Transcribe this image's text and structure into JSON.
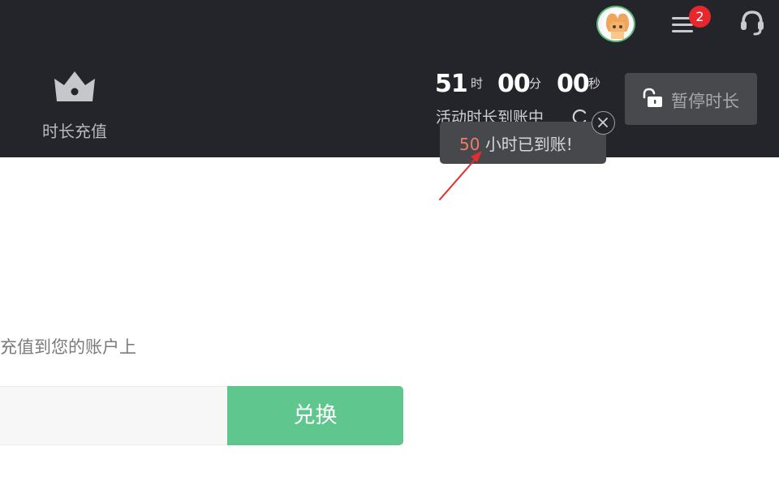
{
  "header": {
    "notification_count": "2",
    "recharge_nav": {
      "label": "时长充值",
      "icon": "crown-icon"
    },
    "timer": {
      "hours": "51",
      "hours_unit": "时",
      "minutes": "00",
      "minutes_unit": "分",
      "seconds": "00",
      "seconds_unit": "秒",
      "status": "活动时长到账中"
    },
    "pause_button": {
      "label": "暂停时长",
      "icon": "unlock-icon"
    }
  },
  "toast": {
    "number": "50",
    "message": "小时已到账!"
  },
  "main": {
    "description": "充值到您的账户上",
    "code_input": {
      "value": "",
      "placeholder": ""
    },
    "redeem_button": {
      "label": "兑换"
    }
  },
  "colors": {
    "header_bg": "#24252a",
    "accent_green": "#5fc68e",
    "badge_red": "#e8262e",
    "toast_highlight": "#ee7b6c",
    "annotation_arrow": "#e52d2d"
  }
}
